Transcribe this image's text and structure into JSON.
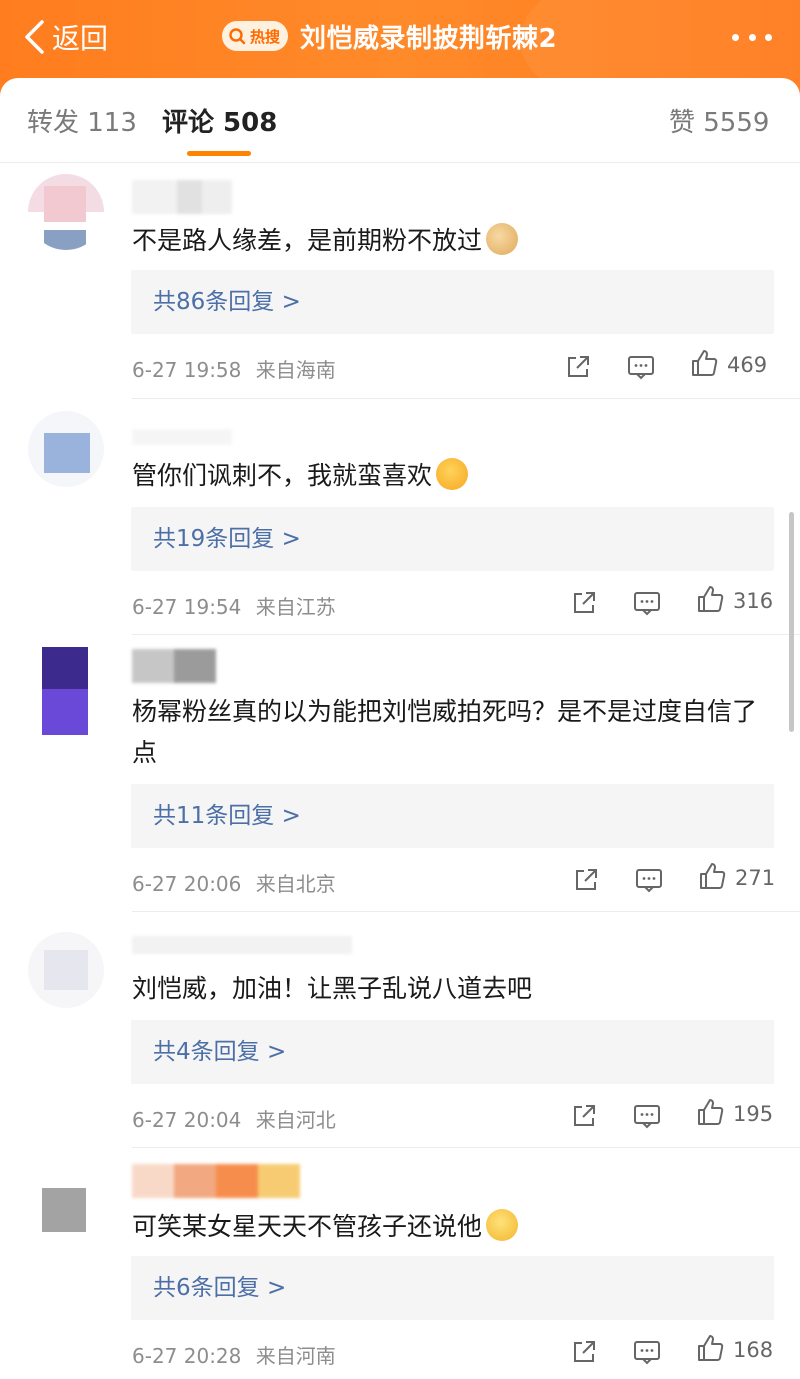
{
  "header": {
    "back_label": "返回",
    "hot_badge": "热搜",
    "title": "刘恺威录制披荆斩棘2"
  },
  "tabs": [
    {
      "label": "转发 113"
    },
    {
      "label": "评论 508"
    },
    {
      "label": "赞 5559"
    }
  ],
  "comments": [
    {
      "text": "不是路人缘差，是前期粉不放过",
      "emoji": "doge-emoji",
      "replies": "共86条回复 >",
      "time": "6-27 19:58",
      "source": "来自海南",
      "likes": "469"
    },
    {
      "text": "管你们讽刺不，我就蛮喜欢",
      "emoji": "hug-emoji",
      "replies": "共19条回复 >",
      "time": "6-27 19:54",
      "source": "来自江苏",
      "likes": "316"
    },
    {
      "text": "杨幂粉丝真的以为能把刘恺威拍死吗？是不是过度自信了点",
      "emoji": "",
      "replies": "共11条回复 >",
      "time": "6-27 20:06",
      "source": "来自北京",
      "likes": "271"
    },
    {
      "text": "刘恺威，加油！让黑子乱说八道去吧",
      "emoji": "",
      "replies": "共4条回复 >",
      "time": "6-27 20:04",
      "source": "来自河北",
      "likes": "195"
    },
    {
      "text": "可笑某女星天天不管孩子还说他",
      "emoji": "facepalm-emoji",
      "replies": "共6条回复 >",
      "time": "6-27 20:28",
      "source": "来自河南",
      "likes": "168"
    }
  ],
  "colors": {
    "header_orange": "#ff7d1e",
    "tab_underline": "#ff8200",
    "reply_link": "#4d6fa7"
  }
}
